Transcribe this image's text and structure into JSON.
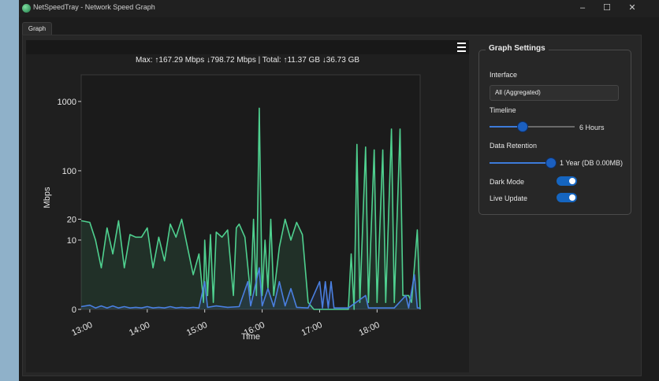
{
  "window": {
    "title": "NetSpeedTray - Network Speed Graph",
    "controls": {
      "minimize": "–",
      "maximize": "☐",
      "close": "✕"
    }
  },
  "tabs": [
    {
      "label": "Graph"
    }
  ],
  "graph": {
    "stats_text": "Max: ↑167.29 Mbps ↓798.72 Mbps | Total: ↑11.37 GB ↓36.73 GB"
  },
  "settings": {
    "title": "Graph Settings",
    "interface_label": "Interface",
    "interface_value": "All (Aggregated)",
    "timeline_label": "Timeline",
    "timeline_value": "6 Hours",
    "timeline_fraction": 0.39,
    "retention_label": "Data Retention",
    "retention_value": "1 Year (DB 0.00MB)",
    "retention_fraction": 1.0,
    "dark_mode_label": "Dark Mode",
    "dark_mode_on": true,
    "live_update_label": "Live Update",
    "live_update_on": true
  },
  "colors": {
    "download": "#4fd08f",
    "upload": "#4a7fe0",
    "toggle_on": "#1565c0"
  },
  "chart_data": {
    "type": "line",
    "xlabel": "Time",
    "ylabel": "Mbps",
    "y_scale": "symlog",
    "yticks": [
      0,
      10,
      20,
      100,
      1000
    ],
    "ytick_labels": [
      "0",
      "10",
      "20",
      "100",
      "1000"
    ],
    "xticks": [
      13,
      14,
      15,
      16,
      17,
      18
    ],
    "xtick_labels": [
      "13:00",
      "14:00",
      "15:00",
      "16:00",
      "17:00",
      "18:00"
    ],
    "xlim": [
      12.85,
      18.75
    ],
    "ylim": [
      0,
      1000
    ],
    "series": [
      {
        "key": "download",
        "values": [
          [
            12.85,
            19
          ],
          [
            13.0,
            18
          ],
          [
            13.1,
            10
          ],
          [
            13.2,
            6
          ],
          [
            13.3,
            15
          ],
          [
            13.4,
            8
          ],
          [
            13.5,
            19
          ],
          [
            13.6,
            6
          ],
          [
            13.7,
            12
          ],
          [
            13.8,
            11
          ],
          [
            13.9,
            11
          ],
          [
            14.0,
            15
          ],
          [
            14.1,
            6
          ],
          [
            14.2,
            11
          ],
          [
            14.3,
            7
          ],
          [
            14.4,
            17
          ],
          [
            14.5,
            11
          ],
          [
            14.6,
            20
          ],
          [
            14.7,
            9
          ],
          [
            14.8,
            5
          ],
          [
            14.9,
            8
          ],
          [
            14.98,
            1
          ],
          [
            15.0,
            10
          ],
          [
            15.05,
            2
          ],
          [
            15.1,
            12
          ],
          [
            15.15,
            1
          ],
          [
            15.2,
            13
          ],
          [
            15.3,
            11
          ],
          [
            15.4,
            14
          ],
          [
            15.5,
            2
          ],
          [
            15.55,
            15
          ],
          [
            15.6,
            17
          ],
          [
            15.7,
            11
          ],
          [
            15.8,
            2
          ],
          [
            15.85,
            20
          ],
          [
            15.9,
            2
          ],
          [
            15.95,
            800
          ],
          [
            16.0,
            2
          ],
          [
            16.05,
            10
          ],
          [
            16.1,
            3
          ],
          [
            16.15,
            20
          ],
          [
            16.2,
            2
          ],
          [
            16.3,
            9
          ],
          [
            16.4,
            20
          ],
          [
            16.5,
            10
          ],
          [
            16.6,
            18
          ],
          [
            16.7,
            12
          ],
          [
            16.8,
            1
          ],
          [
            16.9,
            0
          ],
          [
            17.5,
            0
          ],
          [
            17.55,
            8
          ],
          [
            17.6,
            0
          ],
          [
            17.65,
            240
          ],
          [
            17.7,
            1
          ],
          [
            17.8,
            220
          ],
          [
            17.85,
            1
          ],
          [
            17.95,
            200
          ],
          [
            18.0,
            1
          ],
          [
            18.1,
            200
          ],
          [
            18.15,
            1
          ],
          [
            18.25,
            400
          ],
          [
            18.3,
            1
          ],
          [
            18.4,
            400
          ],
          [
            18.45,
            2
          ],
          [
            18.55,
            2
          ],
          [
            18.6,
            1
          ],
          [
            18.7,
            14
          ],
          [
            18.75,
            0
          ]
        ]
      },
      {
        "key": "upload",
        "values": [
          [
            12.85,
            0.4
          ],
          [
            13.0,
            0.6
          ],
          [
            13.1,
            0.2
          ],
          [
            13.2,
            0.5
          ],
          [
            13.3,
            0.2
          ],
          [
            13.4,
            0.5
          ],
          [
            13.5,
            0.2
          ],
          [
            13.6,
            0.4
          ],
          [
            13.7,
            0.2
          ],
          [
            13.8,
            0.3
          ],
          [
            13.9,
            0.2
          ],
          [
            14.0,
            0.4
          ],
          [
            14.1,
            0.2
          ],
          [
            14.2,
            0.3
          ],
          [
            14.3,
            0.2
          ],
          [
            14.4,
            0.4
          ],
          [
            14.5,
            0.2
          ],
          [
            14.6,
            0.3
          ],
          [
            14.7,
            0.2
          ],
          [
            14.8,
            0.3
          ],
          [
            14.9,
            0.2
          ],
          [
            15.0,
            4
          ],
          [
            15.05,
            0.3
          ],
          [
            15.2,
            0.5
          ],
          [
            15.4,
            0.3
          ],
          [
            15.6,
            0.4
          ],
          [
            15.75,
            4
          ],
          [
            15.8,
            0.5
          ],
          [
            15.95,
            6
          ],
          [
            16.0,
            0.5
          ],
          [
            16.1,
            3
          ],
          [
            16.2,
            0.4
          ],
          [
            16.3,
            4
          ],
          [
            16.4,
            0.5
          ],
          [
            16.5,
            3
          ],
          [
            16.6,
            0.3
          ],
          [
            16.8,
            0.2
          ],
          [
            17.0,
            4
          ],
          [
            17.05,
            0.2
          ],
          [
            17.1,
            4
          ],
          [
            17.15,
            0.2
          ],
          [
            17.2,
            4
          ],
          [
            17.25,
            0.2
          ],
          [
            17.5,
            0.2
          ],
          [
            17.8,
            2
          ],
          [
            17.85,
            0.2
          ],
          [
            18.0,
            0.2
          ],
          [
            18.3,
            0.2
          ],
          [
            18.5,
            2
          ],
          [
            18.55,
            0.2
          ],
          [
            18.65,
            5
          ],
          [
            18.7,
            0.2
          ],
          [
            18.75,
            0.2
          ]
        ]
      }
    ]
  }
}
